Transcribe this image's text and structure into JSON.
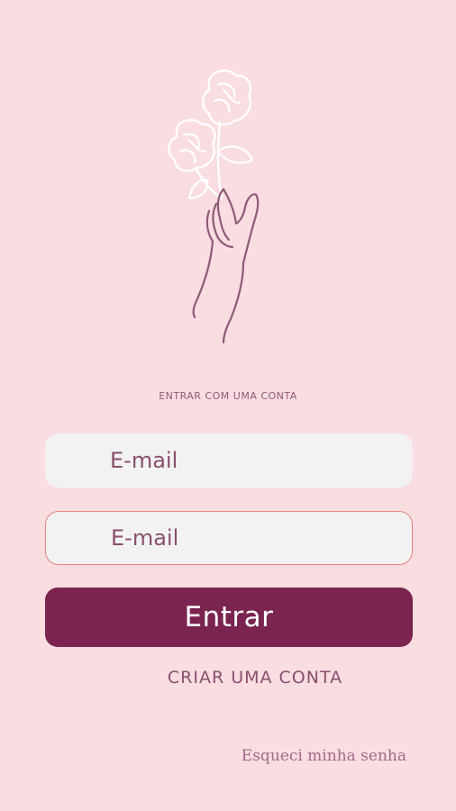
{
  "login": {
    "subtitle": "ENTRAR COM UMA CONTA",
    "email_placeholder": "E-mail",
    "password_placeholder": "E-mail",
    "enter_label": "Entrar",
    "create_label": "CRIAR UMA CONTA",
    "forgot_label": "Esqueci minha senha"
  },
  "illustration": {
    "icon": "hand-holding-roses-icon"
  },
  "colors": {
    "background": "#f9dde1",
    "field_background": "#f2f2f2",
    "field_text": "#8a4f6e",
    "field_focus_border": "#e6827e",
    "button_primary": "#7a244f",
    "button_primary_text": "#ffffff",
    "accent_text": "#8a4f6e",
    "line_art": "#8e5a78",
    "flower_outline": "#ffffff"
  }
}
